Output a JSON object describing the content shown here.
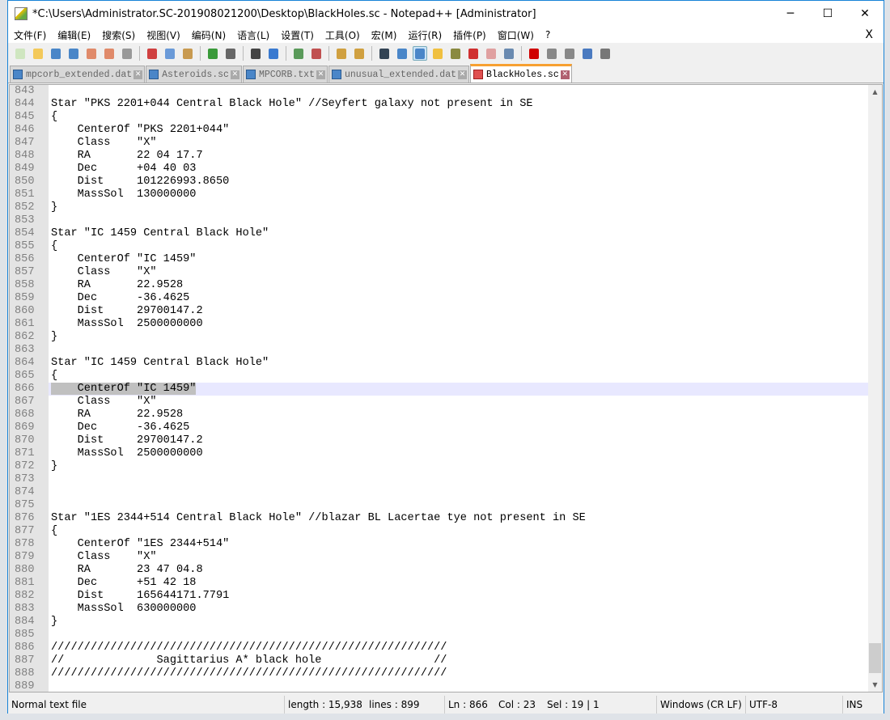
{
  "window": {
    "title": "*C:\\Users\\Administrator.SC-201908021200\\Desktop\\BlackHoles.sc - Notepad++ [Administrator]",
    "minimize": "─",
    "maximize": "☐",
    "close": "✕"
  },
  "menu": [
    "文件(F)",
    "编辑(E)",
    "搜索(S)",
    "视图(V)",
    "编码(N)",
    "语言(L)",
    "设置(T)",
    "工具(O)",
    "宏(M)",
    "运行(R)",
    "插件(P)",
    "窗口(W)",
    "?"
  ],
  "menu_close": "X",
  "toolbar": [
    "new-icon",
    "open-icon",
    "save-icon",
    "save-all-icon",
    "close-icon",
    "close-all-icon",
    "print-icon",
    "|",
    "cut-icon",
    "copy-icon",
    "paste-icon",
    "|",
    "undo-icon",
    "redo-icon",
    "|",
    "find-icon",
    "replace-icon",
    "|",
    "zoom-in-icon",
    "zoom-out-icon",
    "|",
    "sync-v-icon",
    "sync-h-icon",
    "|",
    "wrap-icon",
    "all-chars-icon",
    "indent-guide-icon",
    "udl-icon",
    "doc-map-icon",
    "function-list-icon",
    "folder-workspace-icon",
    "monitor-icon",
    "|",
    "record-icon",
    "stop-icon",
    "play-icon",
    "run-multi-icon",
    "save-macro-icon"
  ],
  "tabs": [
    {
      "label": "mpcorb_extended.dat",
      "active": false
    },
    {
      "label": "Asteroids.sc",
      "active": false
    },
    {
      "label": "MPCORB.txt",
      "active": false
    },
    {
      "label": "unusual_extended.dat",
      "active": false
    },
    {
      "label": "BlackHoles.sc",
      "active": true
    }
  ],
  "editor": {
    "current_line": 866,
    "lines": [
      {
        "n": "843",
        "t": ""
      },
      {
        "n": "844",
        "t": "Star \"PKS 2201+044 Central Black Hole\" //Seyfert galaxy not present in SE"
      },
      {
        "n": "845",
        "t": "{"
      },
      {
        "n": "846",
        "t": "    CenterOf \"PKS 2201+044\""
      },
      {
        "n": "847",
        "t": "    Class    \"X\""
      },
      {
        "n": "848",
        "t": "    RA       22 04 17.7"
      },
      {
        "n": "849",
        "t": "    Dec      +04 40 03"
      },
      {
        "n": "850",
        "t": "    Dist     101226993.8650"
      },
      {
        "n": "851",
        "t": "    MassSol  130000000"
      },
      {
        "n": "852",
        "t": "}"
      },
      {
        "n": "853",
        "t": ""
      },
      {
        "n": "854",
        "t": "Star \"IC 1459 Central Black Hole\""
      },
      {
        "n": "855",
        "t": "{"
      },
      {
        "n": "856",
        "t": "    CenterOf \"IC 1459\""
      },
      {
        "n": "857",
        "t": "    Class    \"X\""
      },
      {
        "n": "858",
        "t": "    RA       22.9528"
      },
      {
        "n": "859",
        "t": "    Dec      -36.4625"
      },
      {
        "n": "860",
        "t": "    Dist     29700147.2"
      },
      {
        "n": "861",
        "t": "    MassSol  2500000000"
      },
      {
        "n": "862",
        "t": "}"
      },
      {
        "n": "863",
        "t": ""
      },
      {
        "n": "864",
        "t": "Star \"IC 1459 Central Black Hole\""
      },
      {
        "n": "865",
        "t": "{"
      },
      {
        "n": "866",
        "t": "    CenterOf \"IC 1459\""
      },
      {
        "n": "867",
        "t": "    Class    \"X\""
      },
      {
        "n": "868",
        "t": "    RA       22.9528"
      },
      {
        "n": "869",
        "t": "    Dec      -36.4625"
      },
      {
        "n": "870",
        "t": "    Dist     29700147.2"
      },
      {
        "n": "871",
        "t": "    MassSol  2500000000"
      },
      {
        "n": "872",
        "t": "}"
      },
      {
        "n": "873",
        "t": ""
      },
      {
        "n": "874",
        "t": ""
      },
      {
        "n": "875",
        "t": ""
      },
      {
        "n": "876",
        "t": "Star \"1ES 2344+514 Central Black Hole\" //blazar BL Lacertae tye not present in SE"
      },
      {
        "n": "877",
        "t": "{"
      },
      {
        "n": "878",
        "t": "    CenterOf \"1ES 2344+514\""
      },
      {
        "n": "879",
        "t": "    Class    \"X\""
      },
      {
        "n": "880",
        "t": "    RA       23 47 04.8"
      },
      {
        "n": "881",
        "t": "    Dec      +51 42 18"
      },
      {
        "n": "882",
        "t": "    Dist     165644171.7791"
      },
      {
        "n": "883",
        "t": "    MassSol  630000000"
      },
      {
        "n": "884",
        "t": "}"
      },
      {
        "n": "885",
        "t": ""
      },
      {
        "n": "886",
        "t": "////////////////////////////////////////////////////////////"
      },
      {
        "n": "887",
        "t": "//              Sagittarius A* black hole                 //"
      },
      {
        "n": "888",
        "t": "////////////////////////////////////////////////////////////"
      },
      {
        "n": "889",
        "t": ""
      }
    ]
  },
  "status": {
    "type": "Normal text file",
    "length": "length : 15,938",
    "lines": "lines : 899",
    "ln": "Ln : 866",
    "col": "Col : 23",
    "sel": "Sel : 19 | 1",
    "eol": "Windows (CR LF)",
    "encoding": "UTF-8",
    "mode": "INS"
  }
}
